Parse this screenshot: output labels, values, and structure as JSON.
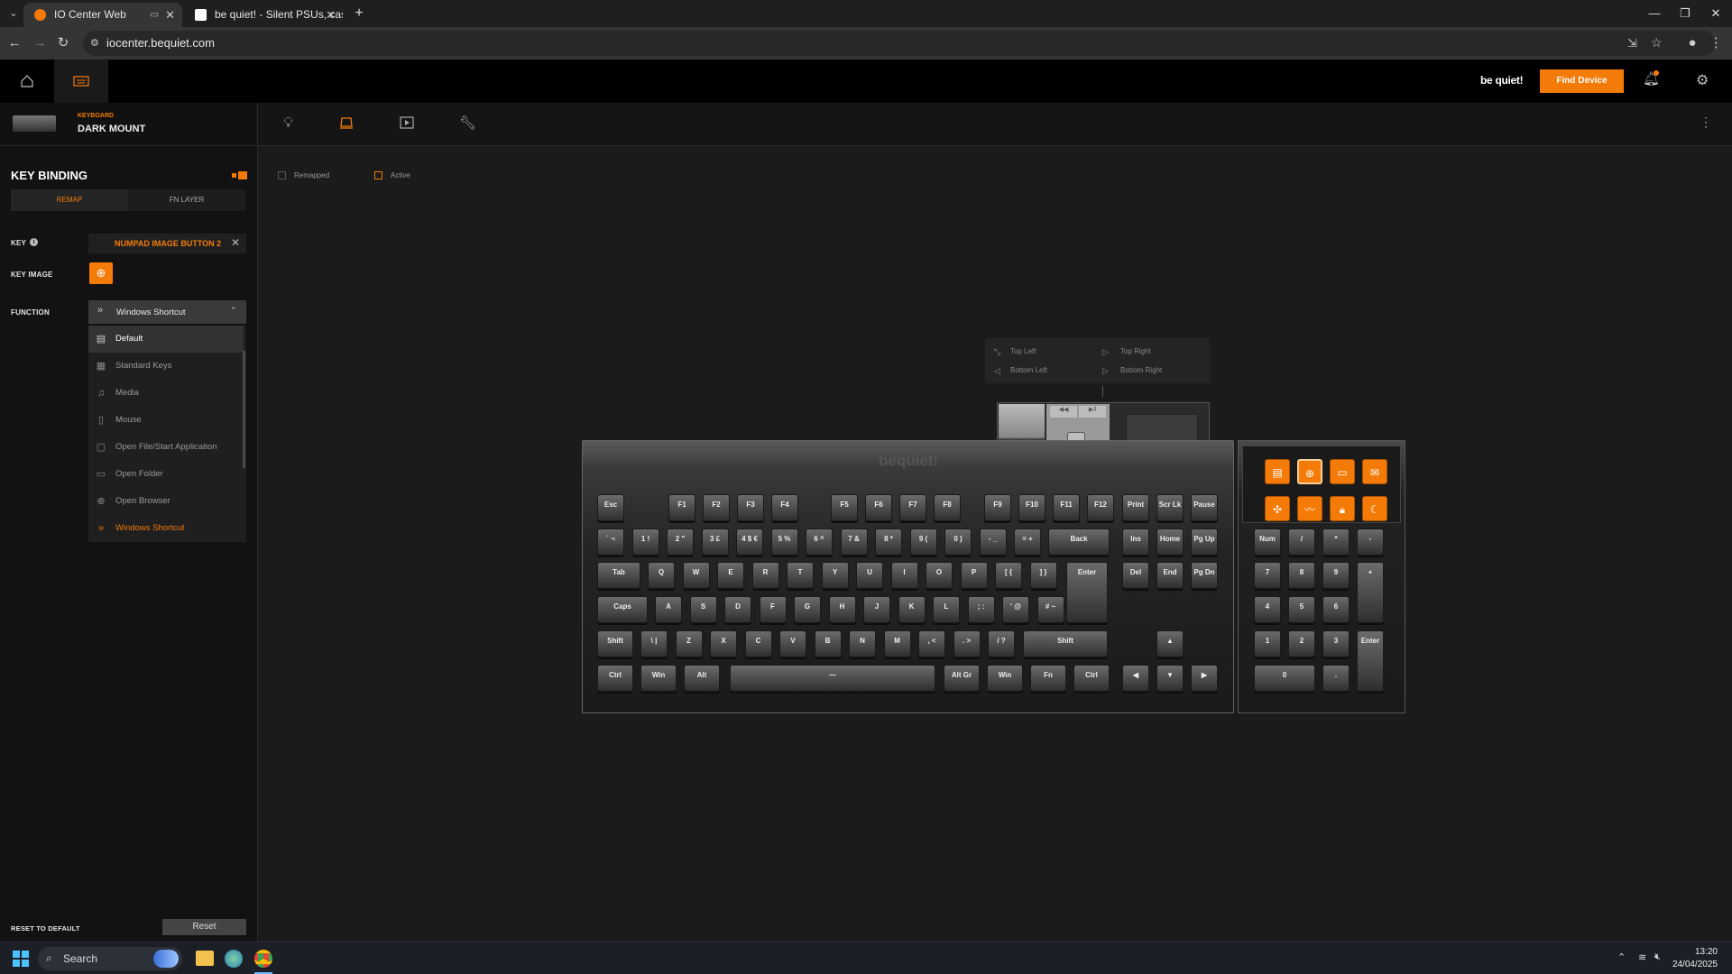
{
  "browser": {
    "tabs": [
      {
        "title": "IO Center Web",
        "active": true
      },
      {
        "title": "be quiet! - Silent PSUs, cases a",
        "active": false
      }
    ],
    "url": "iocenter.bequiet.com"
  },
  "header": {
    "brand": "be quiet!",
    "find_device": "Find Device"
  },
  "device": {
    "category": "KEYBOARD",
    "name": "DARK MOUNT"
  },
  "sidebar": {
    "title": "KEY BINDING",
    "tabs": [
      "REMAP",
      "FN LAYER"
    ],
    "key_label": "KEY",
    "key_value": "NUMPAD IMAGE BUTTON 2",
    "key_image_label": "KEY IMAGE",
    "function_label": "FUNCTION",
    "function_value": "Windows Shortcut",
    "function_options": [
      {
        "label": "Default",
        "icon": "keyboard-icon"
      },
      {
        "label": "Standard Keys",
        "icon": "keys-icon"
      },
      {
        "label": "Media",
        "icon": "music-icon"
      },
      {
        "label": "Mouse",
        "icon": "mouse-icon"
      },
      {
        "label": "Open File/Start Application",
        "icon": "file-icon"
      },
      {
        "label": "Open Folder",
        "icon": "folder-icon"
      },
      {
        "label": "Open Browser",
        "icon": "globe-icon"
      },
      {
        "label": "Windows Shortcut",
        "icon": "shortcut-icon"
      }
    ],
    "reset_label": "RESET TO DEFAULT",
    "reset_button": "Reset"
  },
  "legend": {
    "remapped": "Remapped",
    "active": "Active"
  },
  "corner_menu": {
    "top_left": "Top Left",
    "top_right": "Top Right",
    "bottom_left": "Bottom Left",
    "bottom_right": "Bottom Right"
  },
  "keyboard": {
    "logo": "bequiet!",
    "fn_row": [
      "Esc",
      "F1",
      "F2",
      "F3",
      "F4",
      "F5",
      "F6",
      "F7",
      "F8",
      "F9",
      "F10",
      "F11",
      "F12",
      "Print",
      "Scr Lk",
      "Pause"
    ],
    "num_row": [
      "` ¬",
      "1 !",
      "2 \"",
      "3 £",
      "4 $ €",
      "5 %",
      "6 ^",
      "7 &",
      "8 *",
      "9 (",
      "0 )",
      "- _",
      "= +",
      "Back",
      "Ins",
      "Home",
      "Pg Up"
    ],
    "tab_row": [
      "Tab",
      "Q",
      "W",
      "E",
      "R",
      "T",
      "Y",
      "U",
      "I",
      "O",
      "P",
      "[ {",
      "] }",
      "Enter",
      "Del",
      "End",
      "Pg Dn"
    ],
    "caps_row": [
      "Caps",
      "A",
      "S",
      "D",
      "F",
      "G",
      "H",
      "J",
      "K",
      "L",
      "; :",
      "' @",
      "# ~"
    ],
    "shift_row": [
      "Shift",
      "\\ |",
      "Z",
      "X",
      "C",
      "V",
      "B",
      "N",
      "M",
      ", <",
      ". >",
      "/ ?",
      "Shift",
      "▲"
    ],
    "ctrl_row": [
      "Ctrl",
      "Win",
      "Alt",
      "—",
      "Alt Gr",
      "Win",
      "Fn",
      "Ctrl",
      "◀",
      "▼",
      "▶"
    ],
    "numpad": [
      "Num",
      "/",
      "*",
      "-",
      "7",
      "8",
      "9",
      "+",
      "4",
      "5",
      "6",
      "1",
      "2",
      "3",
      "Enter",
      "0",
      "."
    ]
  },
  "taskbar": {
    "search": "Search",
    "time": "13:20",
    "date": "24/04/2025"
  },
  "colors": {
    "accent": "#f47b07"
  }
}
